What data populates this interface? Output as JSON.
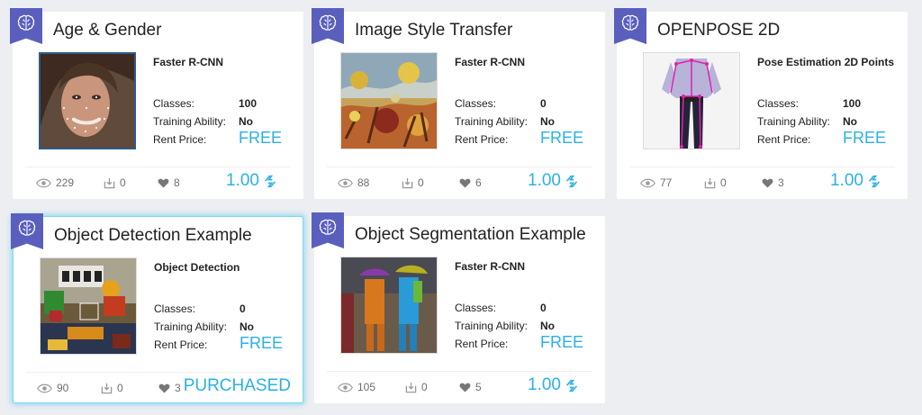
{
  "colors": {
    "accent": "#2bb0e6",
    "badge": "#5a5fbd",
    "background": "#eceef1"
  },
  "labels": {
    "classes": "Classes:",
    "training": "Training Ability:",
    "rent": "Rent Price:"
  },
  "cards": [
    {
      "title": "Age & Gender",
      "model": "Faster R-CNN",
      "classes": "100",
      "training": "No",
      "rent": "FREE",
      "views": "229",
      "downloads": "0",
      "likes": "8",
      "price": "1.00"
    },
    {
      "title": "Image Style Transfer",
      "model": "Faster R-CNN",
      "classes": "0",
      "training": "No",
      "rent": "FREE",
      "views": "88",
      "downloads": "0",
      "likes": "6",
      "price": "1.00"
    },
    {
      "title": "OPENPOSE 2D",
      "model": "Pose Estimation 2D Points",
      "classes": "100",
      "training": "No",
      "rent": "FREE",
      "views": "77",
      "downloads": "0",
      "likes": "3",
      "price": "1.00"
    },
    {
      "title": "Object Detection Example",
      "model": "Object Detection",
      "classes": "0",
      "training": "No",
      "rent": "FREE",
      "views": "90",
      "downloads": "0",
      "likes": "3",
      "price": "PURCHASED"
    },
    {
      "title": "Object Segmentation Example",
      "model": "Faster R-CNN",
      "classes": "0",
      "training": "No",
      "rent": "FREE",
      "views": "105",
      "downloads": "0",
      "likes": "5",
      "price": "1.00"
    }
  ]
}
